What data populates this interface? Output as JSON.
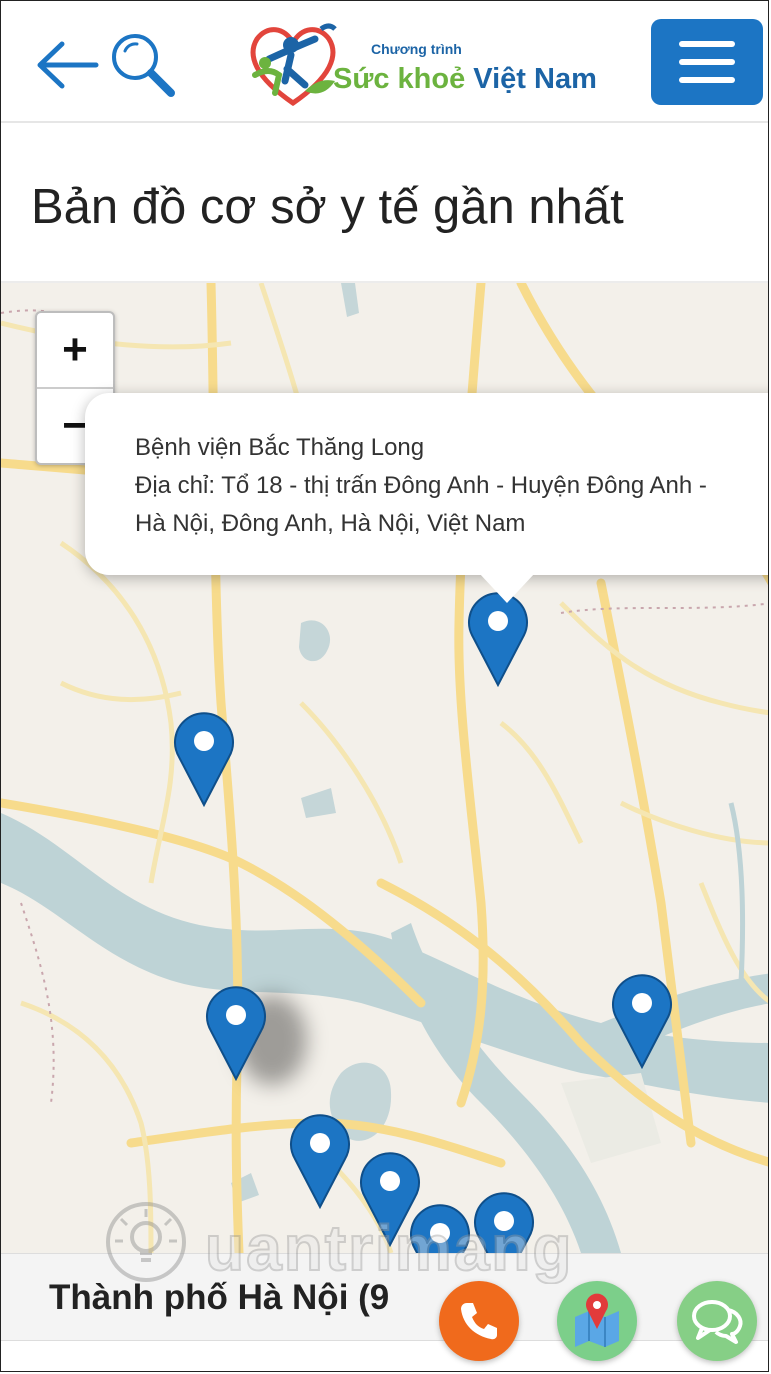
{
  "header": {
    "back_icon": "arrow-left-icon",
    "search_icon": "search-icon",
    "logo": {
      "small_text": "Chương trình",
      "main_green": "Sức khoẻ",
      "main_blue": "Việt Nam"
    },
    "menu_icon": "hamburger-menu-icon"
  },
  "page": {
    "title": "Bản đồ cơ sở y tế gần nhất"
  },
  "map": {
    "zoom_in_label": "+",
    "zoom_out_label": "−",
    "popup": {
      "name": "Bệnh viện Bắc Thăng Long",
      "address_line1": "Địa chỉ: Tổ 18 - thị trấn Đông Anh - Huyện Đông Anh -",
      "address_line2": "Hà Nội, Đông Anh, Hà Nội, Việt Nam"
    },
    "marker_color": "#1c75c4"
  },
  "bottom": {
    "city_label": "Thành phố Hà Nội (9",
    "call_icon": "phone-icon",
    "map_icon": "map-pin-icon",
    "chat_icon": "chat-bubble-icon"
  },
  "watermark": {
    "text": "uantrimang"
  },
  "colors": {
    "brand_blue": "#1c75c4",
    "brand_green": "#6cb33f",
    "call_orange": "#f06a1c",
    "map_green": "#7ccf8a"
  }
}
